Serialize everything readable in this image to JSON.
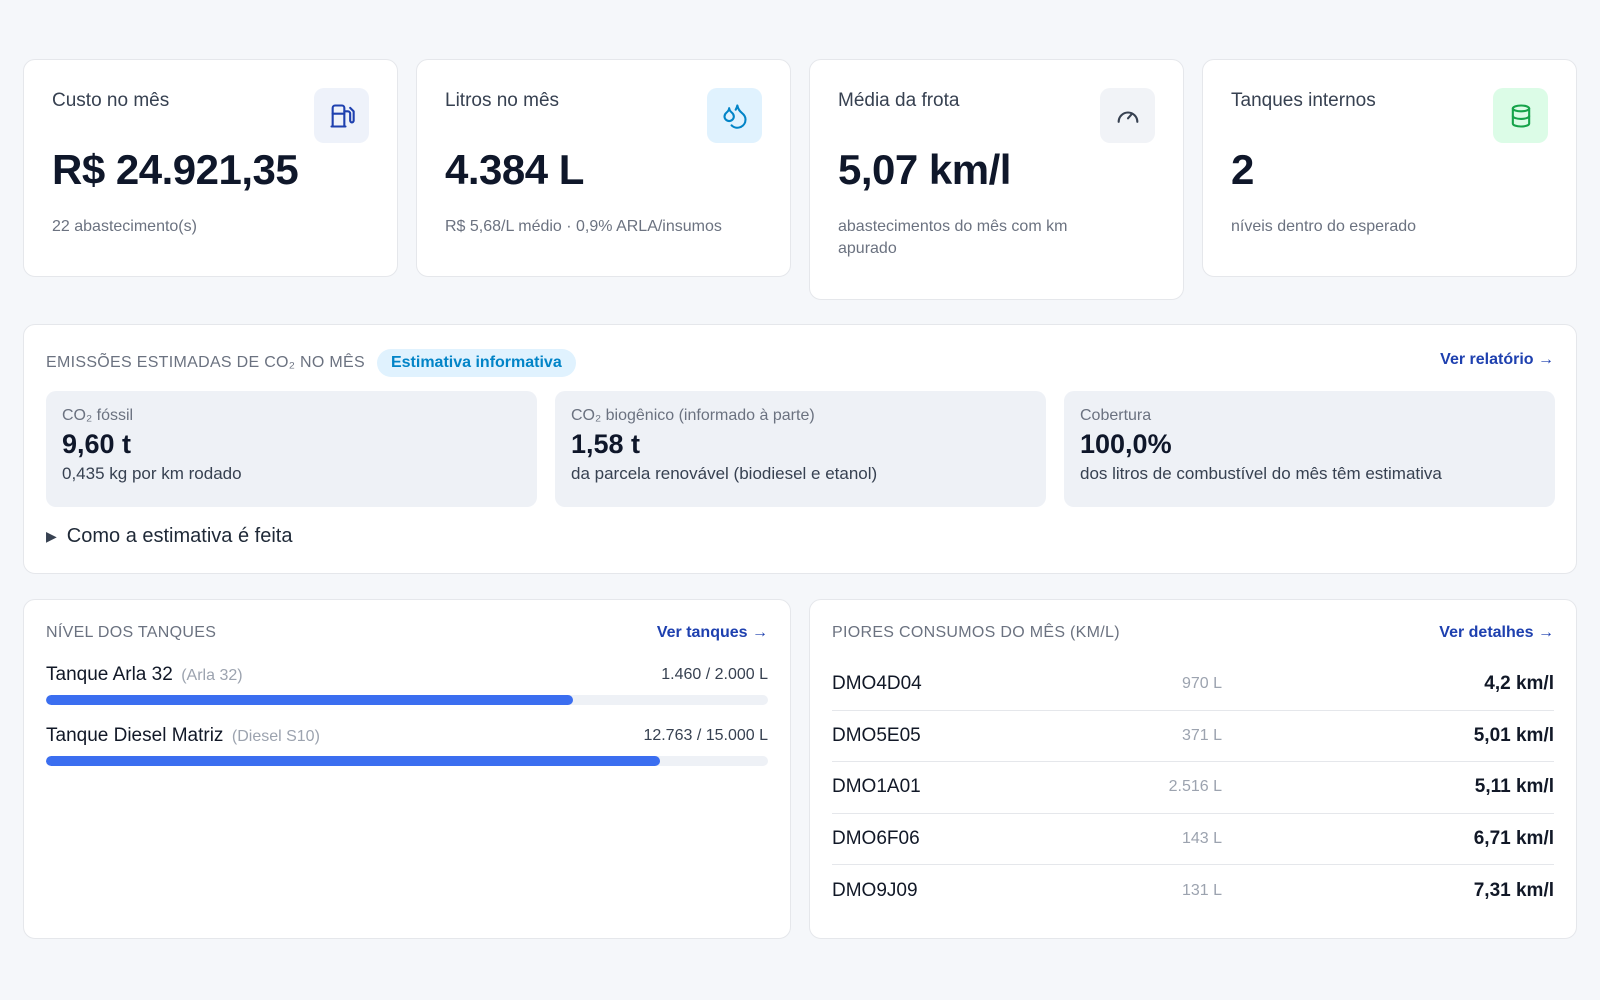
{
  "kpis": [
    {
      "title": "Custo no mês",
      "value": "R$ 24.921,35",
      "sub": "22 abastecimento(s)",
      "icon": "fuel-pump-icon",
      "icon_bg": "#eef2fa",
      "icon_color": "#1e40af"
    },
    {
      "title": "Litros no mês",
      "value": "4.384 L",
      "sub": "R$ 5,68/L médio · 0,9% ARLA/insumos",
      "icon": "droplets-icon",
      "icon_bg": "#e0f2fe",
      "icon_color": "#0284c7"
    },
    {
      "title": "Média da frota",
      "value": "5,07 km/l",
      "sub": "abastecimentos do mês com km apurado",
      "icon": "gauge-icon",
      "icon_bg": "#f1f3f7",
      "icon_color": "#374151"
    },
    {
      "title": "Tanques internos",
      "value": "2",
      "sub": "níveis dentro do esperado",
      "icon": "cylinder-icon",
      "icon_bg": "#dcfce7",
      "icon_color": "#16a34a"
    }
  ],
  "emissions": {
    "title": "EMISSÕES ESTIMADAS DE CO₂ NO MÊS",
    "badge": "Estimativa informativa",
    "link": "Ver relatório →",
    "tiles": [
      {
        "label": "CO₂ fóssil",
        "value": "9,60 t",
        "sub": "0,435 kg por km rodado"
      },
      {
        "label": "CO₂ biogênico (informado à parte)",
        "value": "1,58 t",
        "sub": "da parcela renovável (biodiesel e etanol)"
      },
      {
        "label": "Cobertura",
        "value": "100,0%",
        "sub": "dos litros de combustível do mês têm estimativa"
      }
    ],
    "details_label": "Como a estimativa é feita"
  },
  "tanks": {
    "title": "NÍVEL DOS TANQUES",
    "link": "Ver tanques →",
    "items": [
      {
        "name": "Tanque Arla 32",
        "type": "(Arla 32)",
        "amount": "1.460 / 2.000 L",
        "level": 0.73
      },
      {
        "name": "Tanque Diesel Matriz",
        "type": "(Diesel S10)",
        "amount": "12.763 / 15.000 L",
        "level": 0.8509
      }
    ]
  },
  "worst": {
    "title": "PIORES CONSUMOS DO MÊS (KM/L)",
    "link": "Ver detalhes →",
    "rows": [
      {
        "plate": "DMO4D04",
        "liters": "970 L",
        "kml": "4,2 km/l"
      },
      {
        "plate": "DMO5E05",
        "liters": "371 L",
        "kml": "5,01 km/l"
      },
      {
        "plate": "DMO1A01",
        "liters": "2.516 L",
        "kml": "5,11 km/l"
      },
      {
        "plate": "DMO6F06",
        "liters": "143 L",
        "kml": "6,71 km/l"
      },
      {
        "plate": "DMO9J09",
        "liters": "131 L",
        "kml": "7,31 km/l"
      }
    ]
  }
}
